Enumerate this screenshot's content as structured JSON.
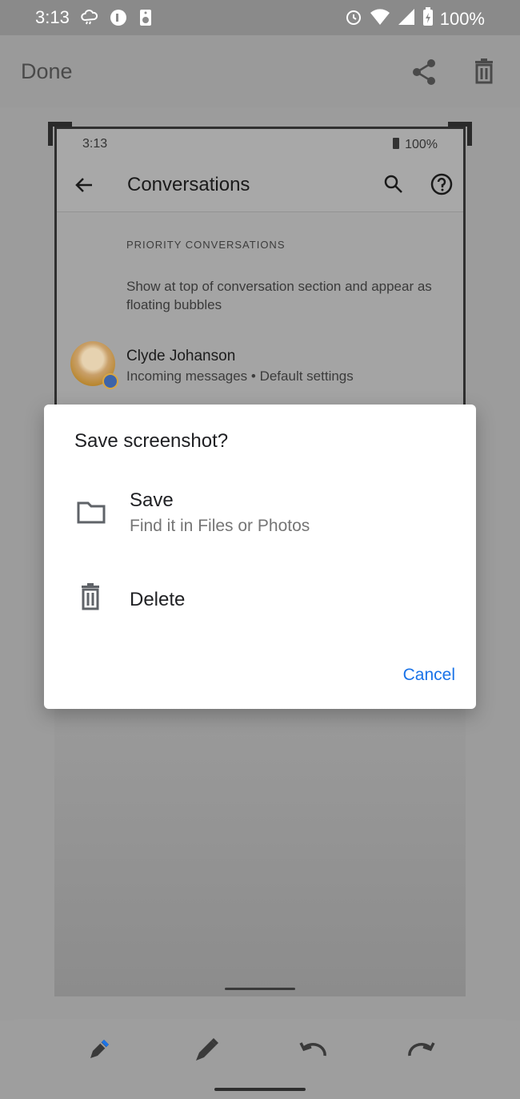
{
  "status_bar": {
    "time": "3:13",
    "battery": "100%"
  },
  "editor": {
    "done_label": "Done"
  },
  "preview": {
    "status_time": "3:13",
    "status_battery": "100%",
    "title": "Conversations",
    "section_header": "PRIORITY CONVERSATIONS",
    "section_description": "Show at top of conversation section and appear as floating bubbles",
    "contact_name": "Clyde Johanson",
    "contact_subtitle": "Incoming messages • Default settings"
  },
  "dialog": {
    "title": "Save screenshot?",
    "options": [
      {
        "label": "Save",
        "subtitle": "Find it in Files or Photos",
        "icon": "folder-icon"
      },
      {
        "label": "Delete",
        "icon": "trash-icon"
      }
    ],
    "cancel_label": "Cancel"
  },
  "toolbar": {
    "tools": [
      "pen-icon",
      "marker-icon",
      "undo-icon",
      "redo-icon"
    ]
  },
  "colors": {
    "accent": "#1a73e8",
    "scrim": "#9e9e9e",
    "dialog_bg": "#ffffff"
  }
}
